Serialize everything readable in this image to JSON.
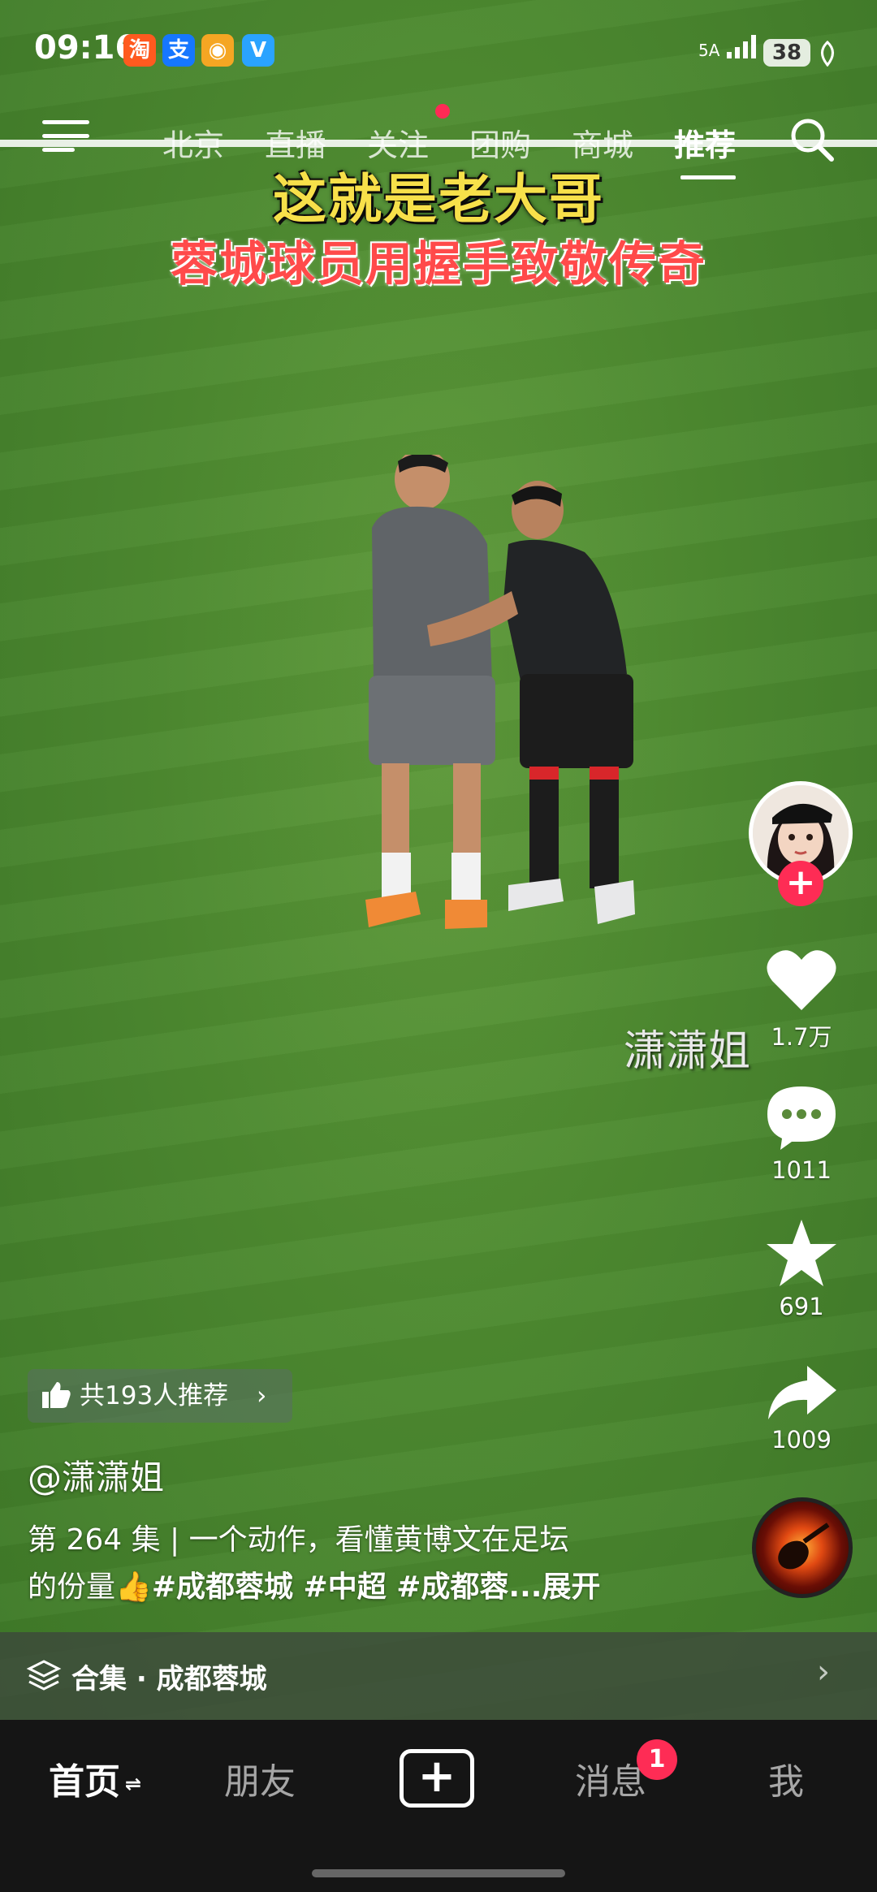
{
  "status_bar": {
    "time": "09:16",
    "app_icons": [
      {
        "name": "taobao-icon",
        "glyph": "淘",
        "color": "#ff5a1f"
      },
      {
        "name": "alipay-icon",
        "glyph": "支",
        "color": "#1677ff"
      },
      {
        "name": "weibo-icon",
        "glyph": "◉",
        "color": "#f5a623"
      },
      {
        "name": "verified-app-icon",
        "glyph": "V",
        "color": "#2aa3ff"
      }
    ],
    "network": "5A",
    "battery": "38"
  },
  "top_nav": {
    "tabs": [
      "北京",
      "直播",
      "关注",
      "团购",
      "商城",
      "推荐"
    ],
    "active_tab": "推荐"
  },
  "video": {
    "caption_line1": "这就是老大哥",
    "caption_line2": "蓉城球员用握手致敬传奇",
    "watermark": "潇潇姐"
  },
  "actions": {
    "likes": "1.7万",
    "comments": "1011",
    "favorites": "691",
    "shares": "1009"
  },
  "info": {
    "recommend": "共193人推荐",
    "author": "@潇潇姐",
    "desc_line1": "第 264 集 | 一个动作，看懂黄博文在足坛",
    "desc_line2_plain": "的份量",
    "desc_emoji": "👍",
    "desc_tags": "#成都蓉城 #中超 #成都蓉",
    "desc_more": "...展开",
    "collection": "合集 · 成都蓉城"
  },
  "bottom_nav": {
    "home": "首页",
    "friends": "朋友",
    "add": "+",
    "messages": "消息",
    "messages_badge": "1",
    "me": "我"
  }
}
